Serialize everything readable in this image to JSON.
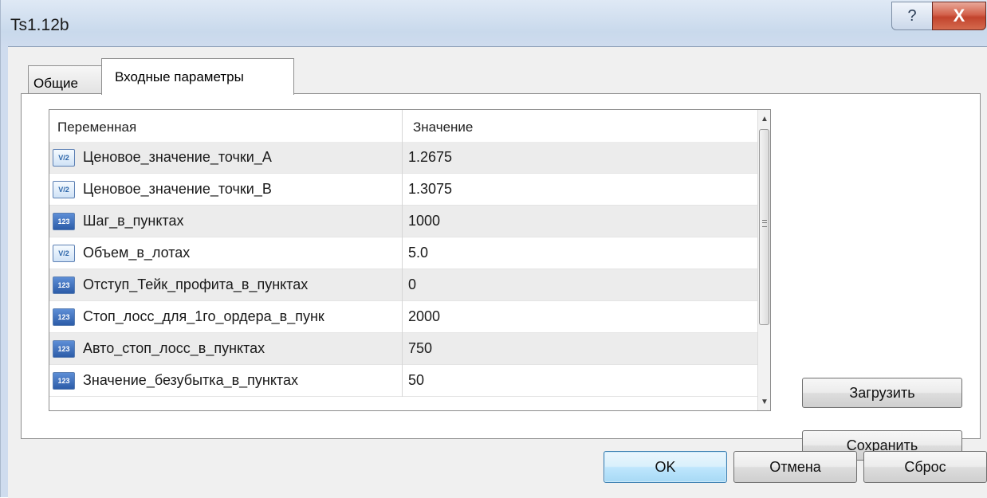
{
  "window": {
    "title": "Ts1.12b",
    "help_glyph": "?",
    "close_glyph": "X",
    "help_icon": "help-question-icon",
    "close_icon": "close-x-icon"
  },
  "tabs": [
    {
      "label": "Общие",
      "active": false
    },
    {
      "label": "Входные параметры",
      "active": true
    }
  ],
  "grid": {
    "headers": {
      "variable": "Переменная",
      "value": "Значение"
    },
    "rows": [
      {
        "type": "double",
        "icon_text": "V/2",
        "name": "Ценовое_значение_точки_А",
        "value": "1.2675"
      },
      {
        "type": "double",
        "icon_text": "V/2",
        "name": "Ценовое_значение_точки_В",
        "value": "1.3075"
      },
      {
        "type": "int",
        "icon_text": "123",
        "name": "Шаг_в_пунктах",
        "value": "1000"
      },
      {
        "type": "double",
        "icon_text": "V/2",
        "name": "Объем_в_лотах",
        "value": "5.0"
      },
      {
        "type": "int",
        "icon_text": "123",
        "name": "Отступ_Тейк_профита_в_пунктах",
        "value": "0"
      },
      {
        "type": "int",
        "icon_text": "123",
        "name": "Стоп_лосс_для_1го_ордера_в_пунк",
        "value": "2000"
      },
      {
        "type": "int",
        "icon_text": "123",
        "name": "Авто_стоп_лосс_в_пунктах",
        "value": "750"
      },
      {
        "type": "int",
        "icon_text": "123",
        "name": "Значение_безубытка_в_пунктах",
        "value": "50"
      }
    ],
    "scroll": {
      "up_glyph": "▲",
      "down_glyph": "▼"
    }
  },
  "side_buttons": {
    "load": "Загрузить",
    "save": "Сохранить"
  },
  "footer_buttons": {
    "ok": "OK",
    "cancel": "Отмена",
    "reset": "Сброс"
  },
  "colors": {
    "ok_border": "#3c7fb1",
    "close_button": "#c2442d",
    "int_icon": "#2c5ca8"
  }
}
